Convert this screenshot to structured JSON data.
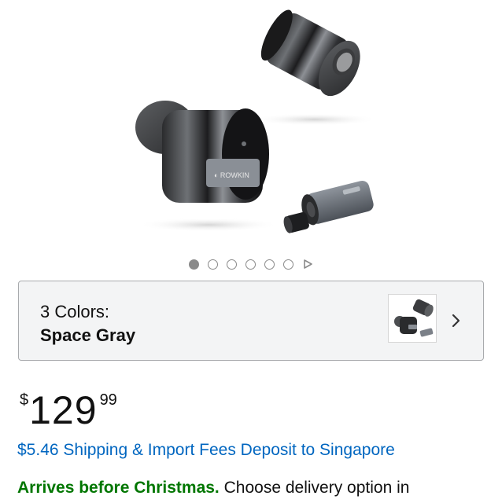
{
  "gallery": {
    "dot_count": 6,
    "active_index": 0,
    "play_icon": "play-icon"
  },
  "variant": {
    "count_label": "3 Colors:",
    "selected_label": "Space Gray",
    "chevron_icon": "chevron-right-icon"
  },
  "price": {
    "symbol": "$",
    "whole": "129",
    "fraction": "99"
  },
  "shipping": {
    "text": "$5.46 Shipping & Import Fees Deposit to Singapore"
  },
  "delivery": {
    "highlight": "Arrives before Christmas.",
    "text": "Choose delivery option in"
  },
  "colors": {
    "link": "#0066c0",
    "delivery_green": "#007600",
    "border": "#a8aaad",
    "box_bg": "#f3f4f5"
  }
}
